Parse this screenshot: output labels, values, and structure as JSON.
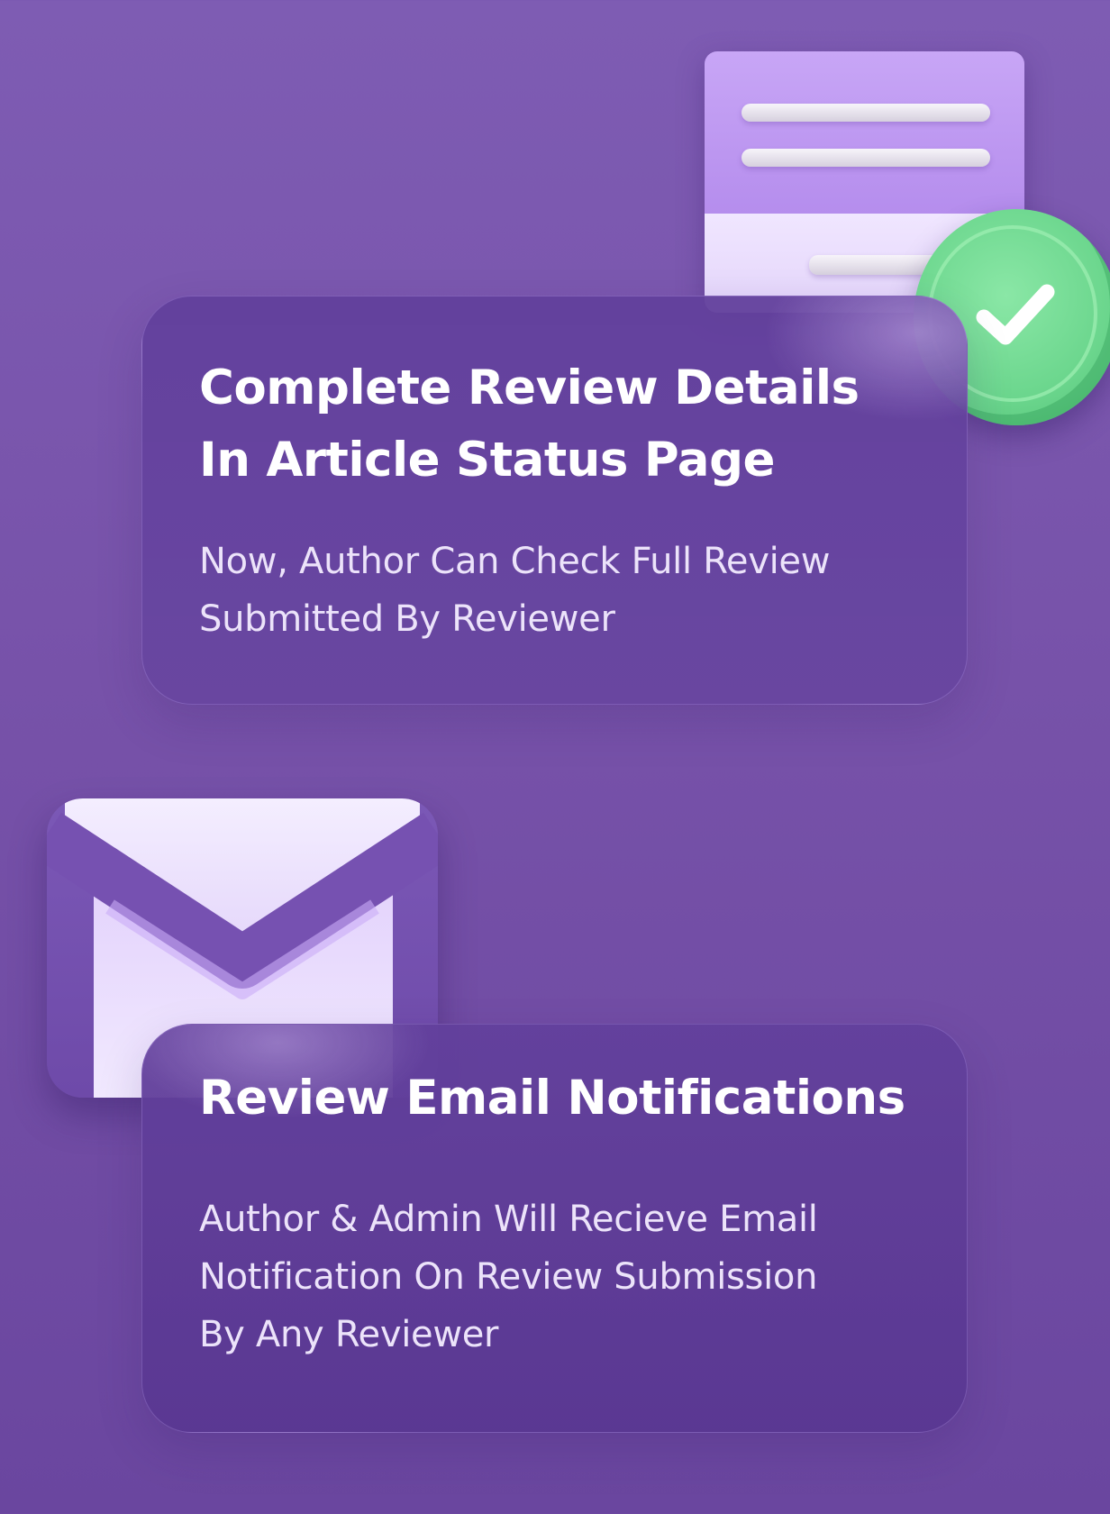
{
  "colors": {
    "background_top": "#7e5cb3",
    "background_bottom": "#6a469f",
    "card": "#5f3d98",
    "check_green": "#6bd68d",
    "document_purple": "#c8a6f6"
  },
  "illustrations": {
    "top": {
      "document_icon": "document-icon",
      "badge_icon": "checkmark-icon"
    },
    "bottom": {
      "envelope_icon": "envelope-icon"
    }
  },
  "features": [
    {
      "title_lines": [
        "Complete Review Details",
        "In Article Status Page"
      ],
      "description_lines": [
        "Now, Author Can Check Full Review",
        "Submitted By Reviewer"
      ]
    },
    {
      "title_lines": [
        "Review Email Notifications"
      ],
      "description_lines": [
        "Author & Admin Will Recieve Email",
        "Notification On Review Submission",
        "By Any Reviewer"
      ]
    }
  ]
}
